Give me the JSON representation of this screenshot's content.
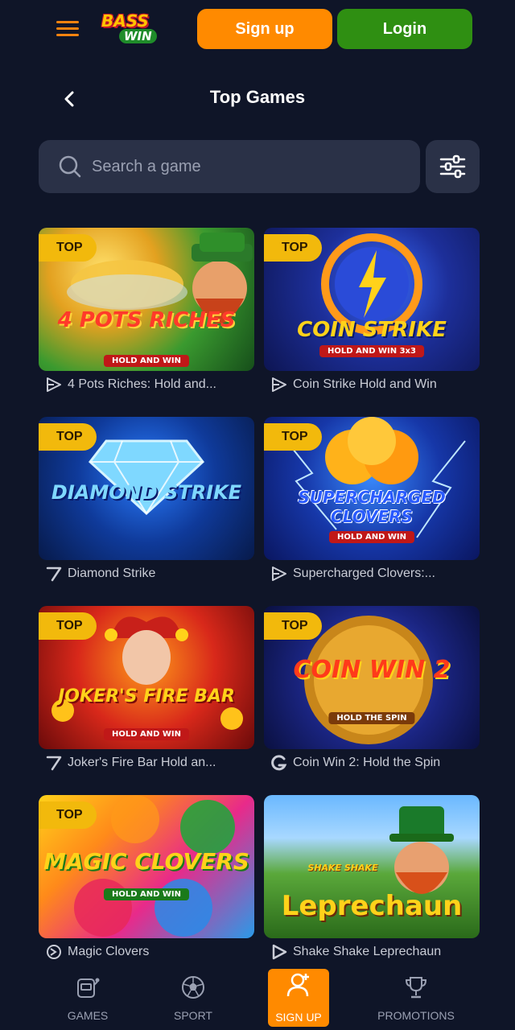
{
  "header": {
    "logo_top": "BASS",
    "logo_bottom": "WIN",
    "signup_label": "Sign up",
    "login_label": "Login"
  },
  "page": {
    "title": "Top Games"
  },
  "search": {
    "placeholder": "Search a game"
  },
  "games": [
    {
      "name": "4 Pots Riches: Hold and...",
      "badge": "TOP",
      "art_title": "4 POTS RICHES",
      "art_sub": "HOLD AND WIN",
      "provider_icon": "play-outline-icon"
    },
    {
      "name": "Coin Strike Hold and Win",
      "badge": "TOP",
      "art_title": "COIN STRIKE",
      "art_sub": "HOLD AND WIN 3x3",
      "provider_icon": "play-outline-icon"
    },
    {
      "name": "Diamond Strike",
      "badge": "TOP",
      "art_title": "DIAMOND STRIKE",
      "art_sub": "",
      "provider_icon": "seven-icon"
    },
    {
      "name": "Supercharged Clovers:...",
      "badge": "TOP",
      "art_title": "SUPERCHARGED CLOVERS",
      "art_sub": "HOLD AND WIN",
      "provider_icon": "play-outline-icon"
    },
    {
      "name": "Joker's Fire Bar Hold an...",
      "badge": "TOP",
      "art_title": "JOKER'S FIRE BAR",
      "art_sub": "HOLD AND WIN",
      "provider_icon": "seven-icon"
    },
    {
      "name": "Coin Win 2: Hold the Spin",
      "badge": "TOP",
      "art_title": "COIN WIN 2",
      "art_sub": "HOLD THE SPIN",
      "provider_icon": "g-letter-icon"
    },
    {
      "name": "Magic Clovers",
      "badge": "TOP",
      "art_title": "MAGIC CLOVERS",
      "art_sub": "HOLD AND WIN",
      "provider_icon": "swirl-icon"
    },
    {
      "name": "Shake Shake Leprechaun",
      "badge": "",
      "art_title": "Leprechaun",
      "art_sub": "SHAKE SHAKE",
      "provider_icon": "play-solid-icon"
    }
  ],
  "bottom_nav": [
    {
      "label": "GAMES",
      "icon": "slot-machine-icon",
      "active": false
    },
    {
      "label": "SPORT",
      "icon": "soccer-ball-icon",
      "active": false
    },
    {
      "label": "SIGN UP",
      "icon": "user-plus-icon",
      "active": true
    },
    {
      "label": "PROMOTIONS",
      "icon": "trophy-icon",
      "active": false
    }
  ],
  "colors": {
    "background": "#0f1528",
    "signup": "#ff8a00",
    "login": "#2f8f12",
    "badge": "#f2b90c",
    "surface": "#2a3147"
  }
}
